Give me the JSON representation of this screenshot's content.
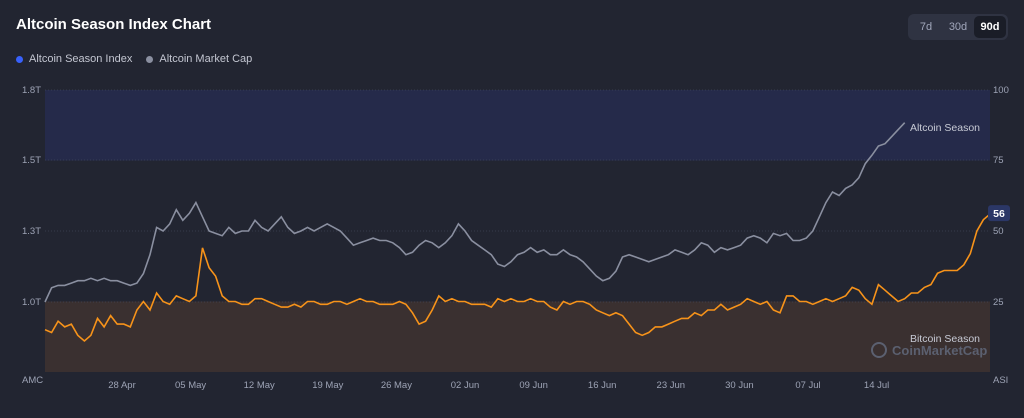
{
  "title": "Altcoin Season Index Chart",
  "ranges": [
    {
      "label": "7d",
      "active": false
    },
    {
      "label": "30d",
      "active": false
    },
    {
      "label": "90d",
      "active": true
    }
  ],
  "legend": [
    {
      "label": "Altcoin Season Index",
      "color": "#3861fb"
    },
    {
      "label": "Altcoin Market Cap",
      "color": "#8a8fa0"
    }
  ],
  "watermark": "CoinMarketCap",
  "chart_data": {
    "type": "line",
    "x_ticks": [
      "28 Apr",
      "05 May",
      "12 May",
      "19 May",
      "26 May",
      "02 Jun",
      "09 Jun",
      "16 Jun",
      "23 Jun",
      "30 Jun",
      "07 Jul",
      "14 Jul"
    ],
    "y_left_ticks": [
      "1.8T",
      "1.5T",
      "1.3T",
      "1.0T",
      "AMC"
    ],
    "y_right_ticks": [
      "100",
      "75",
      "50",
      "25",
      "ASI"
    ],
    "zones": [
      {
        "label": "Altcoin Season",
        "from": 75,
        "to": 100,
        "color": "#252a4a"
      },
      {
        "label": "Bitcoin Season",
        "from": 0,
        "to": 25,
        "color": "#3a3030"
      }
    ],
    "end_value_label": "56",
    "colors": {
      "asi_line": "#f7931a",
      "mcap_line": "#8a8fa0",
      "end_badge": "#2b3766"
    },
    "series": [
      {
        "name": "Altcoin Season Index",
        "values": [
          15,
          14,
          18,
          16,
          17,
          13,
          11,
          13,
          19,
          16,
          20,
          17,
          17,
          16,
          22,
          25,
          22,
          28,
          25,
          24,
          27,
          26,
          25,
          27,
          44,
          37,
          34,
          27,
          25,
          25,
          24,
          24,
          26,
          26,
          25,
          24,
          23,
          23,
          24,
          23,
          25,
          25,
          24,
          24,
          25,
          25,
          24,
          25,
          26,
          25,
          25,
          24,
          24,
          24,
          25,
          24,
          21,
          17,
          18,
          22,
          27,
          25,
          26,
          25,
          25,
          24,
          24,
          24,
          23,
          26,
          25,
          26,
          25,
          25,
          26,
          25,
          25,
          23,
          22,
          25,
          24,
          25,
          25,
          24,
          22,
          21,
          20,
          21,
          20,
          17,
          14,
          13,
          14,
          16,
          16,
          17,
          18,
          19,
          19,
          21,
          20,
          22,
          22,
          24,
          22,
          23,
          24,
          26,
          25,
          24,
          25,
          22,
          21,
          27,
          27,
          25,
          25,
          24,
          25,
          26,
          25,
          26,
          27,
          30,
          29,
          26,
          24,
          31,
          29,
          27,
          25,
          26,
          28,
          28,
          30,
          31,
          35,
          36,
          36,
          36,
          38,
          42,
          50,
          54,
          56
        ]
      },
      {
        "name": "Altcoin Market Cap",
        "unit": "T",
        "values": [
          1.0,
          1.06,
          1.07,
          1.07,
          1.08,
          1.09,
          1.09,
          1.1,
          1.09,
          1.1,
          1.09,
          1.09,
          1.08,
          1.07,
          1.08,
          1.12,
          1.2,
          1.31,
          1.3,
          1.32,
          1.36,
          1.33,
          1.35,
          1.38,
          1.34,
          1.3,
          1.29,
          1.28,
          1.31,
          1.29,
          1.3,
          1.3,
          1.33,
          1.31,
          1.3,
          1.32,
          1.34,
          1.31,
          1.29,
          1.3,
          1.31,
          1.3,
          1.31,
          1.32,
          1.31,
          1.3,
          1.27,
          1.24,
          1.25,
          1.26,
          1.27,
          1.26,
          1.26,
          1.25,
          1.23,
          1.2,
          1.21,
          1.24,
          1.26,
          1.25,
          1.23,
          1.25,
          1.28,
          1.32,
          1.3,
          1.26,
          1.24,
          1.22,
          1.2,
          1.16,
          1.15,
          1.17,
          1.2,
          1.21,
          1.23,
          1.21,
          1.22,
          1.2,
          1.2,
          1.22,
          1.2,
          1.19,
          1.17,
          1.14,
          1.11,
          1.09,
          1.1,
          1.13,
          1.19,
          1.2,
          1.19,
          1.18,
          1.17,
          1.18,
          1.19,
          1.2,
          1.22,
          1.21,
          1.2,
          1.22,
          1.25,
          1.24,
          1.21,
          1.23,
          1.22,
          1.23,
          1.24,
          1.27,
          1.28,
          1.27,
          1.25,
          1.29,
          1.28,
          1.29,
          1.26,
          1.26,
          1.27,
          1.3,
          1.34,
          1.38,
          1.41,
          1.4,
          1.42,
          1.43,
          1.45,
          1.49,
          1.52,
          1.56,
          1.57,
          1.6,
          1.63,
          1.66
        ]
      }
    ]
  }
}
